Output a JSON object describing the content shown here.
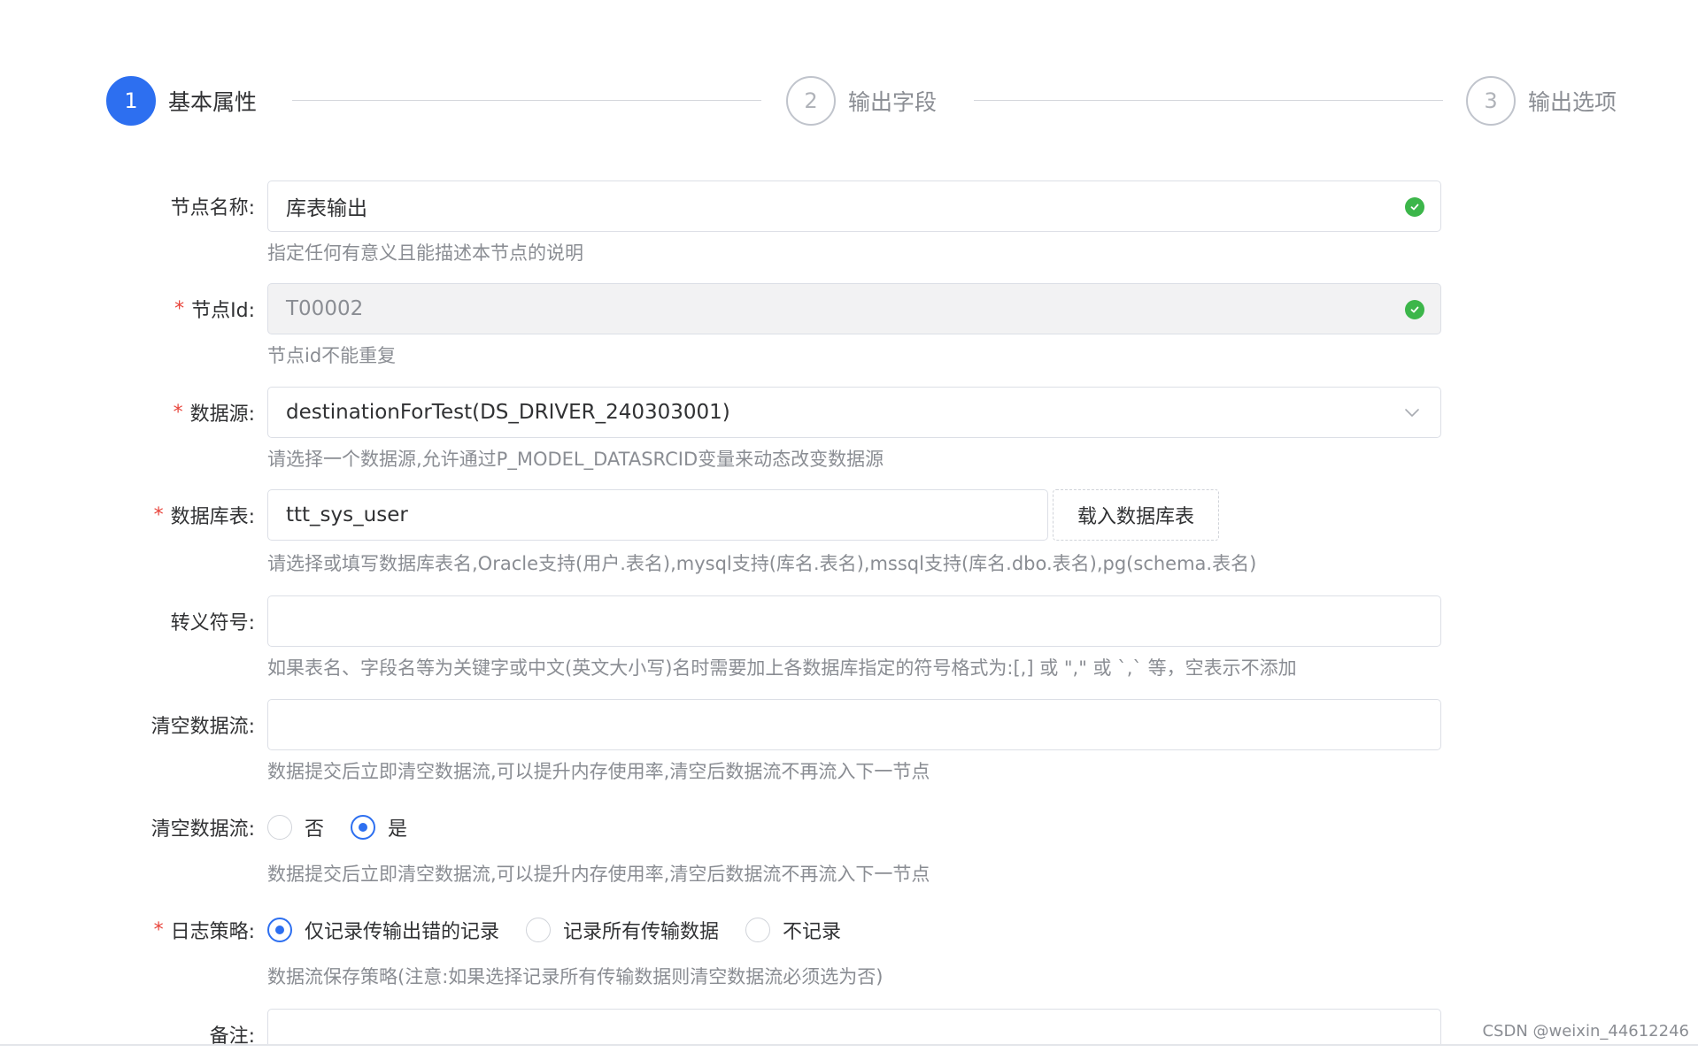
{
  "steps": [
    {
      "num": "1",
      "title": "基本属性",
      "active": true
    },
    {
      "num": "2",
      "title": "输出字段",
      "active": false
    },
    {
      "num": "3",
      "title": "输出选项",
      "active": false
    }
  ],
  "form": {
    "node_name": {
      "label": "节点名称:",
      "value": "库表输出",
      "hint": "指定任何有意义且能描述本节点的说明"
    },
    "node_id": {
      "required_mark": "*",
      "label": "节点Id:",
      "value": "T00002",
      "hint": "节点id不能重复"
    },
    "datasource": {
      "required_mark": "*",
      "label": "数据源:",
      "value": "destinationForTest(DS_DRIVER_240303001)",
      "hint": "请选择一个数据源,允许通过P_MODEL_DATASRCID变量来动态改变数据源"
    },
    "db_table": {
      "required_mark": "*",
      "label": "数据库表:",
      "value": "ttt_sys_user",
      "button": "载入数据库表",
      "hint": "请选择或填写数据库表名,Oracle支持(用户.表名),mysql支持(库名.表名),mssql支持(库名.dbo.表名),pg(schema.表名)"
    },
    "escape_symbol": {
      "label": "转义符号:",
      "value": "",
      "hint": "如果表名、字段名等为关键字或中文(英文大小写)名时需要加上各数据库指定的符号格式为:[,] 或 \",\" 或 `,` 等，空表示不添加"
    },
    "clear_stream_input": {
      "label": "清空数据流:",
      "value": "",
      "hint": "数据提交后立即清空数据流,可以提升内存使用率,清空后数据流不再流入下一节点"
    },
    "clear_stream_radio": {
      "label": "清空数据流:",
      "options": [
        {
          "label": "否",
          "checked": false
        },
        {
          "label": "是",
          "checked": true
        }
      ],
      "hint": "数据提交后立即清空数据流,可以提升内存使用率,清空后数据流不再流入下一节点"
    },
    "log_policy": {
      "required_mark": "*",
      "label": "日志策略:",
      "options": [
        {
          "label": "仅记录传输出错的记录",
          "checked": true
        },
        {
          "label": "记录所有传输数据",
          "checked": false
        },
        {
          "label": "不记录",
          "checked": false
        }
      ],
      "hint": "数据流保存策略(注意:如果选择记录所有传输数据则清空数据流必须选为否)"
    },
    "remark": {
      "label": "备注:",
      "value": ""
    }
  },
  "watermark": "CSDN @weixin_44612246",
  "colors": {
    "primary": "#2d6ff0",
    "success": "#3cb64a",
    "required": "#e8453c"
  }
}
